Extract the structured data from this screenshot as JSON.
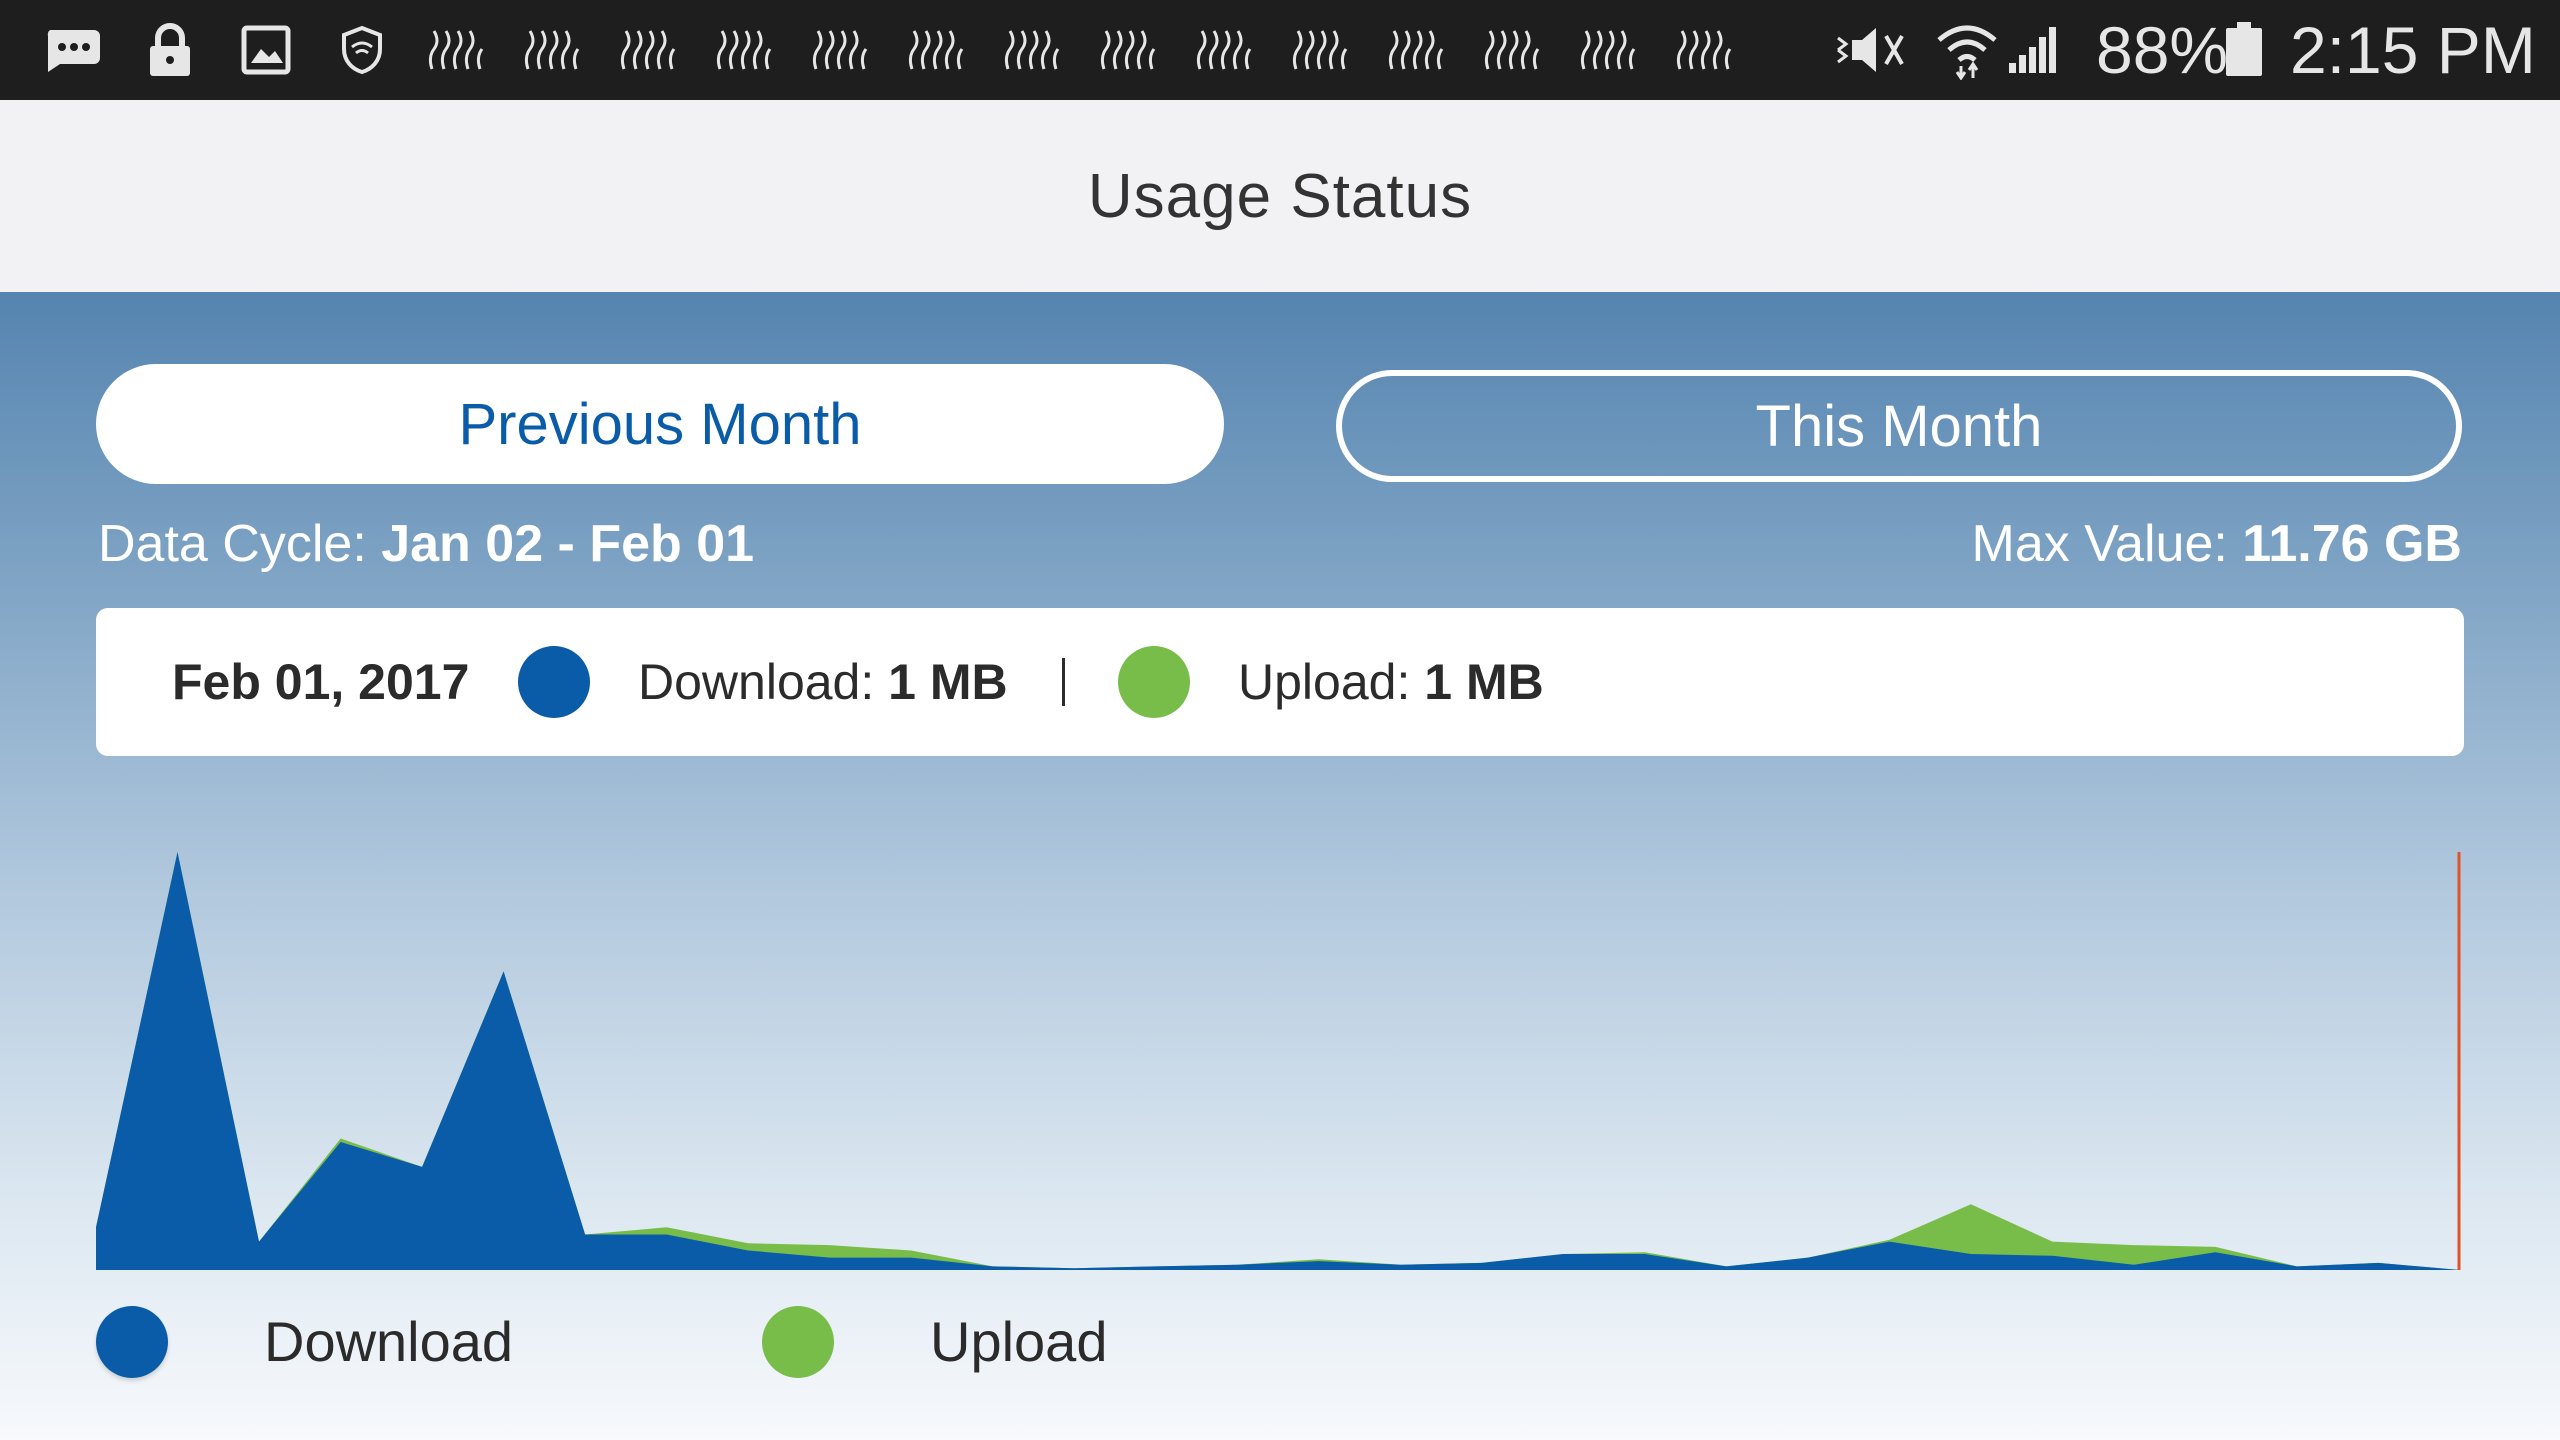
{
  "status_bar": {
    "battery": "88%",
    "time": "2:15 PM",
    "notification_icons": [
      "chat-icon",
      "lock-icon",
      "image-icon",
      "vpn-shield-icon",
      "app-icon",
      "app-icon",
      "app-icon",
      "app-icon",
      "app-icon",
      "app-icon",
      "app-icon",
      "app-icon",
      "app-icon",
      "app-icon",
      "app-icon",
      "app-icon",
      "app-icon",
      "app-icon"
    ]
  },
  "header": {
    "title": "Usage Status"
  },
  "tabs": {
    "previous": "Previous Month",
    "current": "This Month"
  },
  "cycle": {
    "label": "Data Cycle:",
    "value": "Jan 02 - Feb 01"
  },
  "max_value": {
    "label": "Max Value:",
    "value": "11.76 GB"
  },
  "selection": {
    "date": "Feb 01, 2017",
    "download_label": "Download:",
    "download_value": "1 MB",
    "upload_label": "Upload:",
    "upload_value": "1 MB"
  },
  "legend": {
    "download": "Download",
    "upload": "Upload"
  },
  "colors": {
    "download": "#0a5ca8",
    "upload": "#78bd4a",
    "marker": "#e0522a",
    "accent": "#0a5ca8"
  },
  "chart_data": {
    "type": "area",
    "title": "",
    "xlabel": "",
    "ylabel": "",
    "ylim": [
      0,
      11.76
    ],
    "unit": "GB",
    "x_range": [
      "Jan 02",
      "Feb 01"
    ],
    "selected": "Feb 01",
    "series": [
      {
        "name": "Download",
        "values": [
          1.2,
          11.76,
          0.8,
          3.6,
          2.9,
          8.4,
          1.0,
          1.0,
          0.55,
          0.35,
          0.35,
          0.1,
          0.05,
          0.1,
          0.15,
          0.25,
          0.15,
          0.2,
          0.45,
          0.45,
          0.1,
          0.35,
          0.8,
          0.45,
          0.4,
          0.15,
          0.5,
          0.1,
          0.2,
          0.0
        ]
      },
      {
        "name": "Upload",
        "values": [
          1.2,
          11.76,
          0.8,
          3.7,
          2.9,
          8.4,
          1.0,
          1.2,
          0.75,
          0.7,
          0.55,
          0.1,
          0.05,
          0.1,
          0.15,
          0.3,
          0.15,
          0.2,
          0.45,
          0.5,
          0.1,
          0.35,
          0.85,
          1.85,
          0.8,
          0.7,
          0.65,
          0.1,
          0.2,
          0.0
        ]
      }
    ]
  }
}
